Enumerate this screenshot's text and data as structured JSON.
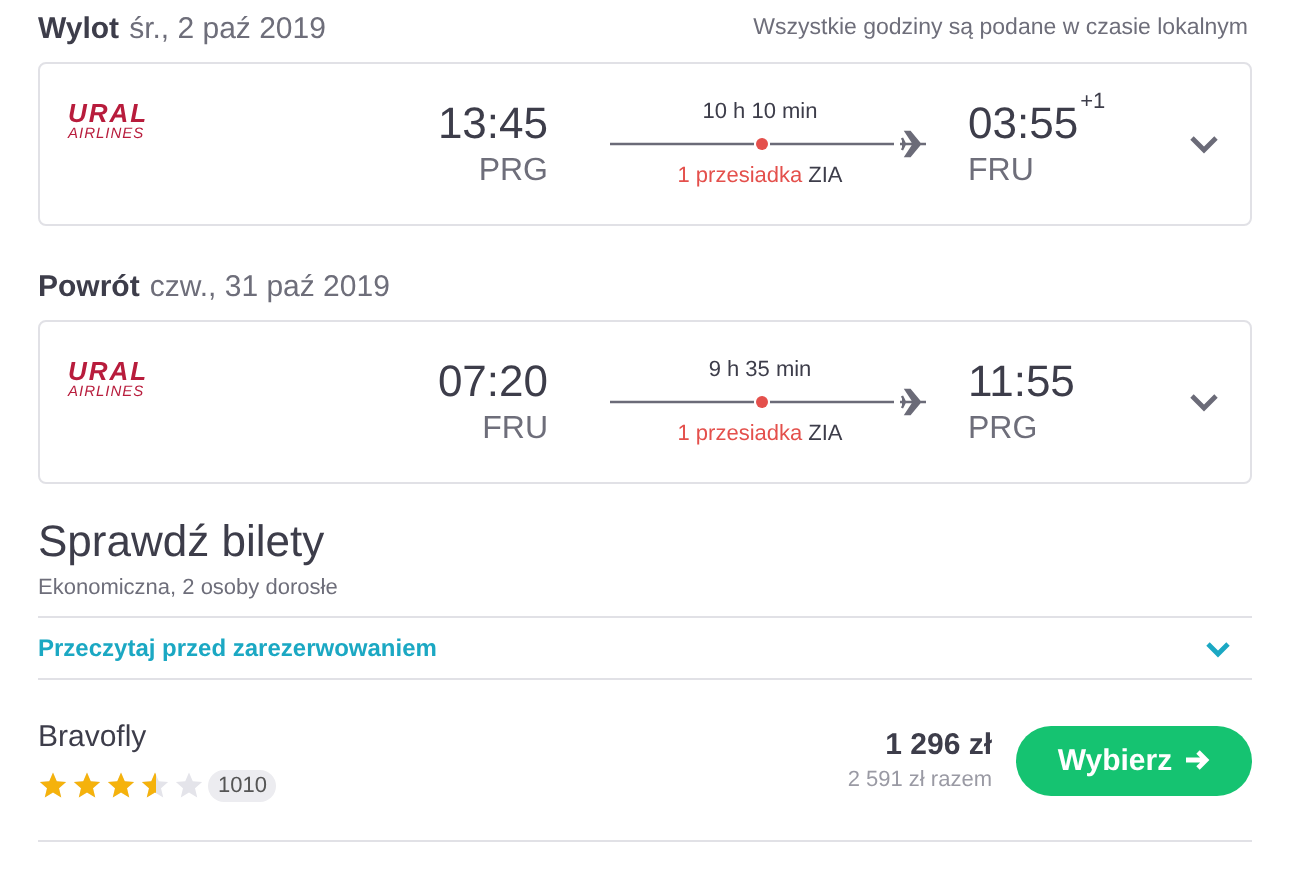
{
  "legs": [
    {
      "label": "Wylot",
      "date": "śr., 2 paź 2019",
      "note": "Wszystkie godziny są podane w czasie lokalnym",
      "airline": {
        "name": "URAL",
        "sub": "AIRLINES"
      },
      "depart_time": "13:45",
      "depart_code": "PRG",
      "duration": "10 h 10 min",
      "stops": "1 przesiadka",
      "via": "ZIA",
      "arrive_time": "03:55",
      "day_offset": "+1",
      "arrive_code": "FRU"
    },
    {
      "label": "Powrót",
      "date": "czw., 31 paź 2019",
      "airline": {
        "name": "URAL",
        "sub": "AIRLINES"
      },
      "depart_time": "07:20",
      "depart_code": "FRU",
      "duration": "9 h 35 min",
      "stops": "1 przesiadka",
      "via": "ZIA",
      "arrive_time": "11:55",
      "arrive_code": "PRG"
    }
  ],
  "tickets": {
    "title": "Sprawdź bilety",
    "subtitle": "Ekonomiczna, 2 osoby dorosłe",
    "info_link": "Przeczytaj przed zarezerwowaniem",
    "expanded": false,
    "offers": [
      {
        "provider": "Bravofly",
        "stars": 3.5,
        "reviews": "1010",
        "price": "1 296 zł",
        "total": "2 591 zł razem",
        "button": "Wybierz"
      }
    ]
  }
}
